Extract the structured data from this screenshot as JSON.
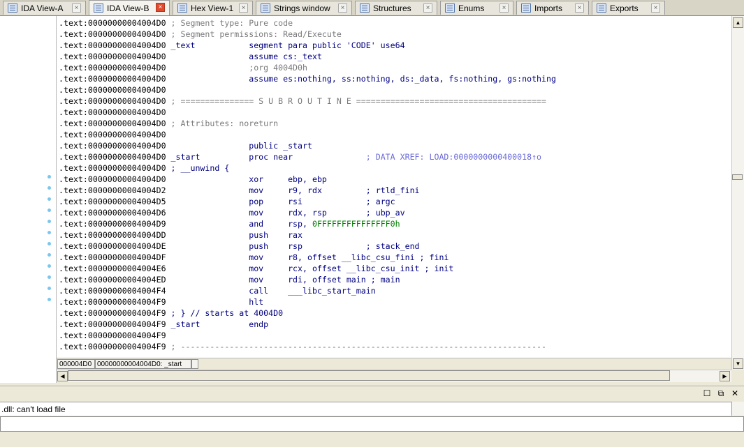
{
  "tabs": [
    {
      "label": "IDA View-A",
      "active": false
    },
    {
      "label": "IDA View-B",
      "active": true
    },
    {
      "label": "Hex View-1",
      "active": false
    },
    {
      "label": "Strings window",
      "active": false
    },
    {
      "label": "Structures",
      "active": false
    },
    {
      "label": "Enums",
      "active": false
    },
    {
      "label": "Imports",
      "active": false
    },
    {
      "label": "Exports",
      "active": false
    }
  ],
  "tab_close_glyph": "×",
  "code": {
    "lines": [
      ".text:00000000004004D0 ; Segment type: Pure code",
      ".text:00000000004004D0 ; Segment permissions: Read/Execute",
      ".text:00000000004004D0 _text           segment para public 'CODE' use64",
      ".text:00000000004004D0                 assume cs:_text",
      ".text:00000000004004D0                 ;org 4004D0h",
      ".text:00000000004004D0                 assume es:nothing, ss:nothing, ds:_data, fs:nothing, gs:nothing",
      ".text:00000000004004D0",
      ".text:00000000004004D0 ; =============== S U B R O U T I N E =======================================",
      ".text:00000000004004D0",
      ".text:00000000004004D0 ; Attributes: noreturn",
      ".text:00000000004004D0",
      ".text:00000000004004D0                 public _start",
      ".text:00000000004004D0 _start          proc near               ; DATA XREF: LOAD:0000000000400018↑o",
      ".text:00000000004004D0 ; __unwind {",
      ".text:00000000004004D0                 xor     ebp, ebp",
      ".text:00000000004004D2                 mov     r9, rdx         ; rtld_fini",
      ".text:00000000004004D5                 pop     rsi             ; argc",
      ".text:00000000004004D6                 mov     rdx, rsp        ; ubp_av",
      ".text:00000000004004D9                 and     rsp, 0FFFFFFFFFFFFFFF0h",
      ".text:00000000004004DD                 push    rax",
      ".text:00000000004004DE                 push    rsp             ; stack_end",
      ".text:00000000004004DF                 mov     r8, offset __libc_csu_fini ; fini",
      ".text:00000000004004E6                 mov     rcx, offset __libc_csu_init ; init",
      ".text:00000000004004ED                 mov     rdi, offset main ; main",
      ".text:00000000004004F4                 call    ___libc_start_main",
      ".text:00000000004004F9                 hlt",
      ".text:00000000004004F9 ; } // starts at 4004D0",
      ".text:00000000004004F9 _start          endp",
      ".text:00000000004004F9",
      ".text:00000000004004F9 ; ---------------------------------------------------------------------------"
    ]
  },
  "status": {
    "offset": "000004D0",
    "location": "00000000004004D0: _start"
  },
  "output": {
    "message": ".dll: can't load file",
    "command_value": ""
  },
  "window_buttons": {
    "minimize": "☐",
    "restore": "⧉",
    "close": "✕"
  },
  "colors": {
    "address": "#000000",
    "comment": "#7a7a7a",
    "instruction": "#000080",
    "number": "#008000",
    "xref": "#6b6bd8",
    "active_close": "#e04a2e",
    "gutter_dot": "#7ac6ee"
  }
}
